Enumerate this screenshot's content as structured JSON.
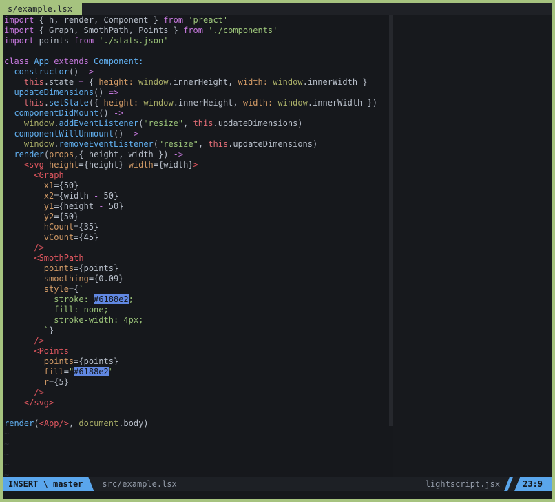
{
  "palette": {
    "border": "#a6c37f",
    "background": "#16181c",
    "tabline_bg": "#1f2126",
    "tab_active_bg": "#a6c37f",
    "tab_active_fg": "#20242b",
    "statusline_bg": "#1d2025",
    "statusline_fg": "#939ba8",
    "mode_segment_bg": "#5aa6ec",
    "mode_segment_fg": "#14171c",
    "separator_bg": "#26282d",
    "tilde": "#2b2f37",
    "syntax": {
      "keyword": "#c678dd",
      "function": "#61afef",
      "string": "#9bc379",
      "attribute": "#d19a66",
      "tag": "#e0565f",
      "this_kw": "#e06c75",
      "support": "#a9ae68",
      "foreground": "#b8bfca",
      "hex_chip_bg": "#6188e2",
      "hex_chip_fg": "#14171c"
    }
  },
  "tabline": {
    "tab": "s/example.lsx"
  },
  "editor": {
    "empty_line_count": 5,
    "tilde": "~",
    "lines": [
      [
        [
          "kw",
          "import"
        ],
        [
          "fg",
          " { h, render, Component } "
        ],
        [
          "kw",
          "from"
        ],
        [
          "str",
          " 'preact'"
        ]
      ],
      [
        [
          "kw",
          "import"
        ],
        [
          "fg",
          " { Graph, SmothPath, Points } "
        ],
        [
          "kw",
          "from"
        ],
        [
          "str",
          " './components'"
        ]
      ],
      [
        [
          "kw",
          "import"
        ],
        [
          "fg",
          " points "
        ],
        [
          "kw",
          "from"
        ],
        [
          "str",
          " './stats.json'"
        ]
      ],
      [],
      [
        [
          "kw",
          "class"
        ],
        [
          "fn",
          " App"
        ],
        [
          "kw",
          " extends"
        ],
        [
          "fn",
          " Component:"
        ]
      ],
      [
        [
          "fg",
          "  "
        ],
        [
          "fn",
          "constructor"
        ],
        [
          "fg",
          "() "
        ],
        [
          "kw",
          "->"
        ]
      ],
      [
        [
          "fg",
          "    "
        ],
        [
          "red",
          "this"
        ],
        [
          "fg",
          ".state "
        ],
        [
          "kw",
          "="
        ],
        [
          "fg",
          " { "
        ],
        [
          "attr",
          "height:"
        ],
        [
          "fg",
          " "
        ],
        [
          "sup",
          "window"
        ],
        [
          "fg",
          ".innerHeight, "
        ],
        [
          "attr",
          "width:"
        ],
        [
          "fg",
          " "
        ],
        [
          "sup",
          "window"
        ],
        [
          "fg",
          ".innerWidth }"
        ]
      ],
      [
        [
          "fg",
          "  "
        ],
        [
          "fn",
          "updateDimensions"
        ],
        [
          "fg",
          "() "
        ],
        [
          "kw",
          "=>"
        ]
      ],
      [
        [
          "fg",
          "    "
        ],
        [
          "red",
          "this"
        ],
        [
          "fg",
          "."
        ],
        [
          "fn",
          "setState"
        ],
        [
          "fg",
          "({ "
        ],
        [
          "attr",
          "height:"
        ],
        [
          "fg",
          " "
        ],
        [
          "sup",
          "window"
        ],
        [
          "fg",
          ".innerHeight, "
        ],
        [
          "attr",
          "width:"
        ],
        [
          "fg",
          " "
        ],
        [
          "sup",
          "window"
        ],
        [
          "fg",
          ".innerWidth })"
        ]
      ],
      [
        [
          "fg",
          "  "
        ],
        [
          "fn",
          "componentDidMount"
        ],
        [
          "fg",
          "() "
        ],
        [
          "kw",
          "->"
        ]
      ],
      [
        [
          "fg",
          "    "
        ],
        [
          "sup",
          "window"
        ],
        [
          "fg",
          "."
        ],
        [
          "fn",
          "addEventListener"
        ],
        [
          "fg",
          "("
        ],
        [
          "str",
          "\"resize\""
        ],
        [
          "fg",
          ", "
        ],
        [
          "red",
          "this"
        ],
        [
          "fg",
          ".updateDimensions)"
        ]
      ],
      [
        [
          "fg",
          "  "
        ],
        [
          "fn",
          "componentWillUnmount"
        ],
        [
          "fg",
          "() "
        ],
        [
          "kw",
          "->"
        ]
      ],
      [
        [
          "fg",
          "    "
        ],
        [
          "sup",
          "window"
        ],
        [
          "fg",
          "."
        ],
        [
          "fn",
          "removeEventListener"
        ],
        [
          "fg",
          "("
        ],
        [
          "str",
          "\"resize\""
        ],
        [
          "fg",
          ", "
        ],
        [
          "red",
          "this"
        ],
        [
          "fg",
          ".updateDimensions)"
        ]
      ],
      [
        [
          "fg",
          "  "
        ],
        [
          "fn",
          "render"
        ],
        [
          "fg",
          "("
        ],
        [
          "attr",
          "props"
        ],
        [
          "fg",
          ",{ height, width }) "
        ],
        [
          "kw",
          "->"
        ]
      ],
      [
        [
          "fg",
          "    "
        ],
        [
          "tag",
          "<svg"
        ],
        [
          "fg",
          " "
        ],
        [
          "attr",
          "height"
        ],
        [
          "fg",
          "={height} "
        ],
        [
          "attr",
          "width"
        ],
        [
          "fg",
          "={width}"
        ],
        [
          "tag",
          ">"
        ]
      ],
      [
        [
          "fg",
          "      "
        ],
        [
          "tag",
          "<Graph"
        ]
      ],
      [
        [
          "fg",
          "        "
        ],
        [
          "attr",
          "x1"
        ],
        [
          "fg",
          "={50}"
        ]
      ],
      [
        [
          "fg",
          "        "
        ],
        [
          "attr",
          "x2"
        ],
        [
          "fg",
          "={width "
        ],
        [
          "kw",
          "-"
        ],
        [
          "fg",
          " 50}"
        ]
      ],
      [
        [
          "fg",
          "        "
        ],
        [
          "attr",
          "y1"
        ],
        [
          "fg",
          "={height "
        ],
        [
          "kw",
          "-"
        ],
        [
          "fg",
          " 50}"
        ]
      ],
      [
        [
          "fg",
          "        "
        ],
        [
          "attr",
          "y2"
        ],
        [
          "fg",
          "={50}"
        ]
      ],
      [
        [
          "fg",
          "        "
        ],
        [
          "attr",
          "hCount"
        ],
        [
          "fg",
          "={35}"
        ]
      ],
      [
        [
          "fg",
          "        "
        ],
        [
          "attr",
          "vCount"
        ],
        [
          "fg",
          "={45}"
        ]
      ],
      [
        [
          "fg",
          "      "
        ],
        [
          "tag",
          "/>"
        ]
      ],
      [
        [
          "fg",
          "      "
        ],
        [
          "tag",
          "<SmothPath"
        ]
      ],
      [
        [
          "fg",
          "        "
        ],
        [
          "attr",
          "points"
        ],
        [
          "fg",
          "={points}"
        ]
      ],
      [
        [
          "fg",
          "        "
        ],
        [
          "attr",
          "smoothing"
        ],
        [
          "fg",
          "={0.09}"
        ]
      ],
      [
        [
          "fg",
          "        "
        ],
        [
          "attr",
          "style"
        ],
        [
          "fg",
          "={"
        ],
        [
          "str",
          "`"
        ]
      ],
      [
        [
          "fg",
          "          "
        ],
        [
          "str",
          "stroke: "
        ],
        [
          "hex",
          "#6188e2"
        ],
        [
          "str",
          ";"
        ]
      ],
      [
        [
          "fg",
          "          "
        ],
        [
          "str",
          "fill: none;"
        ]
      ],
      [
        [
          "fg",
          "          "
        ],
        [
          "str",
          "stroke-width: 4px;"
        ]
      ],
      [
        [
          "fg",
          "        "
        ],
        [
          "str",
          "`"
        ],
        [
          "fg",
          "}"
        ]
      ],
      [
        [
          "fg",
          "      "
        ],
        [
          "tag",
          "/>"
        ]
      ],
      [
        [
          "fg",
          "      "
        ],
        [
          "tag",
          "<Points"
        ]
      ],
      [
        [
          "fg",
          "        "
        ],
        [
          "attr",
          "points"
        ],
        [
          "fg",
          "={points}"
        ]
      ],
      [
        [
          "fg",
          "        "
        ],
        [
          "attr",
          "fill"
        ],
        [
          "fg",
          "="
        ],
        [
          "str",
          "\""
        ],
        [
          "hex",
          "#6188e2"
        ],
        [
          "str",
          "\""
        ]
      ],
      [
        [
          "fg",
          "        "
        ],
        [
          "attr",
          "r"
        ],
        [
          "fg",
          "={5}"
        ]
      ],
      [
        [
          "fg",
          "      "
        ],
        [
          "tag",
          "/>"
        ]
      ],
      [
        [
          "fg",
          "    "
        ],
        [
          "tag",
          "</svg>"
        ]
      ],
      [],
      [
        [
          "fn",
          "render"
        ],
        [
          "fg",
          "("
        ],
        [
          "tag",
          "<App/>"
        ],
        [
          "fg",
          ", "
        ],
        [
          "sup",
          "document"
        ],
        [
          "fg",
          ".body)"
        ]
      ]
    ]
  },
  "statusline": {
    "mode": "INSERT",
    "sub_separator": " \\ ",
    "branch": "master",
    "file": "src/example.lsx",
    "filetype": "lightscript.jsx",
    "position": "23:9"
  }
}
